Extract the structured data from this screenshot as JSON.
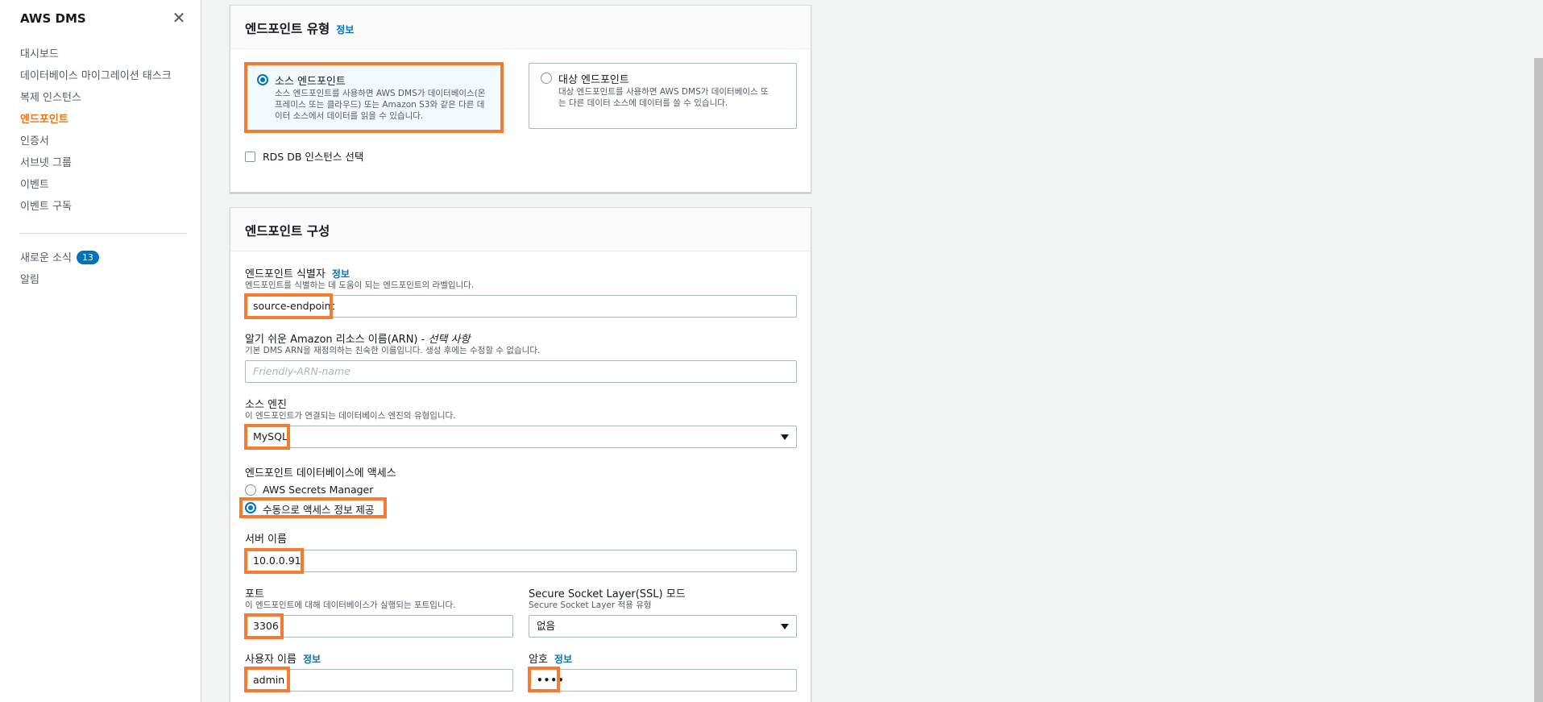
{
  "sidebar": {
    "title": "AWS DMS",
    "close_icon": "close-icon",
    "items": [
      {
        "label": "대시보드"
      },
      {
        "label": "데이터베이스 마이그레이션 태스크"
      },
      {
        "label": "복제 인스턴스"
      },
      {
        "label": "엔드포인트",
        "active": true
      },
      {
        "label": "인증서"
      },
      {
        "label": "서브넷 그룹"
      },
      {
        "label": "이벤트"
      },
      {
        "label": "이벤트 구독"
      }
    ],
    "news_label": "새로운 소식",
    "news_count": "13",
    "alerts_label": "알림"
  },
  "endpoint_type": {
    "title": "엔드포인트 유형",
    "info": "정보",
    "source": {
      "title": "소스 엔드포인트",
      "desc": [
        "소스 엔드포인트를 사용하면 AWS DMS가 데이터베이스(온",
        "프레미스 또는 클라우드) 또는 Amazon S3와 같은 다른 데",
        "이터 소스에서 데이터를 읽을 수 있습니다."
      ],
      "selected": true
    },
    "target": {
      "title": "대상 엔드포인트",
      "desc": [
        "대상 엔드포인트를 사용하면 AWS DMS가 데이터베이스 또",
        "는 다른 데이터 소스에 데이터를 쓸 수 있습니다."
      ],
      "selected": false
    },
    "rds_checkbox_label": "RDS DB 인스턴스 선택"
  },
  "endpoint_config": {
    "title": "엔드포인트 구성",
    "identifier": {
      "label": "엔드포인트 식별자",
      "info": "정보",
      "desc": "엔드포인트를 식별하는 데 도움이 되는 엔드포인트의 라벨입니다.",
      "value": "source-endpoint"
    },
    "arn": {
      "label": "알기 쉬운 Amazon 리소스 이름(ARN) -",
      "optional": "선택 사항",
      "desc": "기본 DMS ARN을 재정의하는 친숙한 이름입니다. 생성 후에는 수정할 수 없습니다.",
      "placeholder": "Friendly-ARN-name"
    },
    "engine": {
      "label": "소스 엔진",
      "desc": "이 엔드포인트가 연결되는 데이터베이스 엔진의 유형입니다.",
      "value": "MySQL"
    },
    "access": {
      "label": "엔드포인트 데이터베이스에 액세스",
      "option_secrets": "AWS Secrets Manager",
      "option_manual": "수동으로 액세스 정보 제공",
      "selected": "manual"
    },
    "server": {
      "label": "서버 이름",
      "value": "10.0.0.91"
    },
    "port": {
      "label": "포트",
      "desc": "이 엔드포인트에 대해 데이터베이스가 실행되는 포트입니다.",
      "value": "3306"
    },
    "ssl": {
      "label": "Secure Socket Layer(SSL) 모드",
      "desc": "Secure Socket Layer 적용 유형",
      "value": "없음"
    },
    "username": {
      "label": "사용자 이름",
      "info": "정보",
      "value": "admin"
    },
    "password": {
      "label": "암호",
      "info": "정보",
      "value": "••••"
    }
  },
  "colors": {
    "accent": "#ec7211",
    "link": "#0073bb",
    "highlight": "#f27c2f"
  }
}
